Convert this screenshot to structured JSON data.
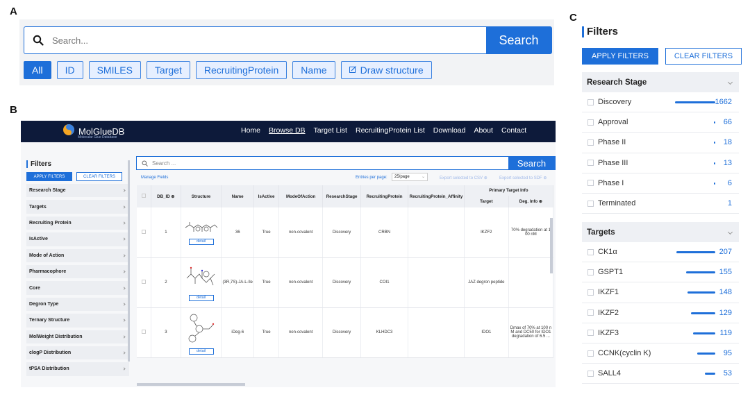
{
  "labels": {
    "a": "A",
    "b": "B",
    "c": "C"
  },
  "panelA": {
    "search_placeholder": "Search...",
    "search_button": "Search",
    "chips": [
      "All",
      "ID",
      "SMILES",
      "Target",
      "RecruitingProtein",
      "Name",
      "Draw structure"
    ],
    "active_chip": "All"
  },
  "panelB": {
    "logo": "MolGlueDB",
    "logo_sub": "Molecular Glue Database",
    "nav": [
      "Home",
      "Browse DB",
      "Target List",
      "RecruitingProtein List",
      "Download",
      "About",
      "Contact"
    ],
    "nav_active": "Browse DB",
    "filters_title": "Filters",
    "apply": "APPLY FILTERS",
    "clear": "CLEAR FILTERS",
    "categories": [
      "Research Stage",
      "Targets",
      "Recruiting Protein",
      "IsActive",
      "Mode of Action",
      "Pharmacophore",
      "Core",
      "Degron Type",
      "Ternary Structure",
      "MolWeight Distribution",
      "clogP Distribution",
      "tPSA Distribution"
    ],
    "search_placeholder": "Search ...",
    "search_button": "Search",
    "manage_fields": "Manage Fields",
    "entries_label": "Entries per page:",
    "entries_value": "25/page",
    "export_csv": "Export selected to CSV ⊕",
    "export_sdf": "Export selected to SDF ⊕",
    "headers": {
      "db_id": "DB_ID ⊕",
      "structure": "Structure",
      "name": "Name",
      "isactive": "IsActive",
      "mode": "ModeOfAction",
      "stage": "ResearchStage",
      "recruit": "RecruitingProtein",
      "affinity": "RecruitingProtein_Affinity",
      "group": "Primary Target Info",
      "target": "Target",
      "deg": "Deg. Info ⊕"
    },
    "detail_label": "detail",
    "rows": [
      {
        "id": "1",
        "name": "36",
        "isactive": "True",
        "mode": "non-covalent",
        "stage": "Discovery",
        "recruit": "CRBN",
        "affinity": "",
        "target": "IKZF2",
        "deg": "70% degradation at 1 00 nM"
      },
      {
        "id": "2",
        "name": "(3R,7S)-JA-L-Ile",
        "isactive": "True",
        "mode": "non-covalent",
        "stage": "Discovery",
        "recruit": "COI1",
        "affinity": "",
        "target": "JAZ degron peptide",
        "deg": ""
      },
      {
        "id": "3",
        "name": "iDeg-6",
        "isactive": "True",
        "mode": "non-covalent",
        "stage": "Discovery",
        "recruit": "KLHDC3",
        "affinity": "",
        "target": "IDO1",
        "deg": "Dmax of 70% at 100 n M and DC50 for IDO1 degradation of 6.5 ..."
      }
    ]
  },
  "panelC": {
    "title": "Filters",
    "apply": "APPLY FILTERS",
    "clear": "CLEAR FILTERS",
    "stage_title": "Research Stage",
    "stages": [
      {
        "label": "Discovery",
        "count": "1662",
        "frac": 1.0
      },
      {
        "label": "Approval",
        "count": "66",
        "frac": 0.04
      },
      {
        "label": "Phase II",
        "count": "18",
        "frac": 0.011
      },
      {
        "label": "Phase III",
        "count": "13",
        "frac": 0.008
      },
      {
        "label": "Phase I",
        "count": "6",
        "frac": 0.004
      },
      {
        "label": "Terminated",
        "count": "1",
        "frac": 0.0
      }
    ],
    "targets_title": "Targets",
    "targets": [
      {
        "label": "CK1α",
        "count": "207",
        "frac": 1.0
      },
      {
        "label": "GSPT1",
        "count": "155",
        "frac": 0.75
      },
      {
        "label": "IKZF1",
        "count": "148",
        "frac": 0.715
      },
      {
        "label": "IKZF2",
        "count": "129",
        "frac": 0.62
      },
      {
        "label": "IKZF3",
        "count": "119",
        "frac": 0.575
      },
      {
        "label": "CCNK(cyclin K)",
        "count": "95",
        "frac": 0.46
      },
      {
        "label": "SALL4",
        "count": "53",
        "frac": 0.26
      }
    ]
  },
  "colors": {
    "accent": "#1e6fd9",
    "nav": "#0d1a3a"
  }
}
